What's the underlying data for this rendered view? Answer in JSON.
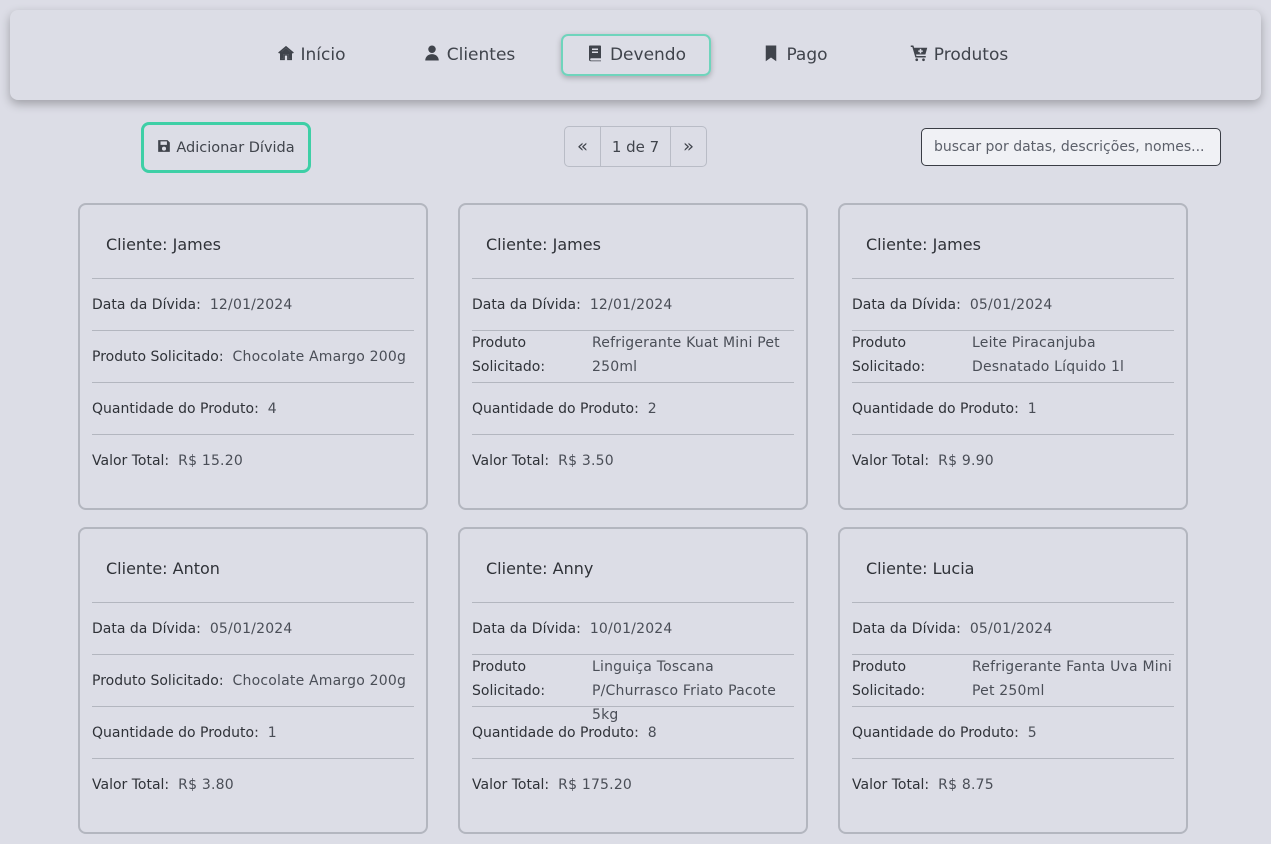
{
  "nav": {
    "items": [
      {
        "label": "Início",
        "icon": "home-icon"
      },
      {
        "label": "Clientes",
        "icon": "user-icon"
      },
      {
        "label": "Devendo",
        "icon": "book-icon",
        "active": true
      },
      {
        "label": "Pago",
        "icon": "bookmark-icon"
      },
      {
        "label": "Produtos",
        "icon": "cart-plus-icon"
      }
    ]
  },
  "toolbar": {
    "add_label": "Adicionar Dívida",
    "pager": {
      "prev": "«",
      "info": "1 de 7",
      "next": "»"
    },
    "search_placeholder": "buscar por datas, descrições, nomes..."
  },
  "labels": {
    "client": "Cliente:",
    "date": "Data da Dívida:",
    "product": "Produto Solicitado:",
    "quantity": "Quantidade do Produto:",
    "total": "Valor Total:"
  },
  "cards": [
    {
      "client": "James",
      "date": "12/01/2024",
      "product": "Chocolate Amargo 200g",
      "quantity": "4",
      "total": "R$ 15.20"
    },
    {
      "client": "James",
      "date": "12/01/2024",
      "product": "Refrigerante Kuat Mini Pet 250ml",
      "quantity": "2",
      "total": "R$ 3.50"
    },
    {
      "client": "James",
      "date": "05/01/2024",
      "product": "Leite Piracanjuba Desnatado Líquido 1l",
      "quantity": "1",
      "total": "R$ 9.90"
    },
    {
      "client": "Anton",
      "date": "05/01/2024",
      "product": "Chocolate Amargo 200g",
      "quantity": "1",
      "total": "R$ 3.80"
    },
    {
      "client": "Anny",
      "date": "10/01/2024",
      "product": "Linguiça Toscana P/Churrasco Friato Pacote 5kg",
      "quantity": "8",
      "total": "R$ 175.20"
    },
    {
      "client": "Lucia",
      "date": "05/01/2024",
      "product": "Refrigerante Fanta Uva Mini Pet 250ml",
      "quantity": "5",
      "total": "R$ 8.75"
    }
  ]
}
